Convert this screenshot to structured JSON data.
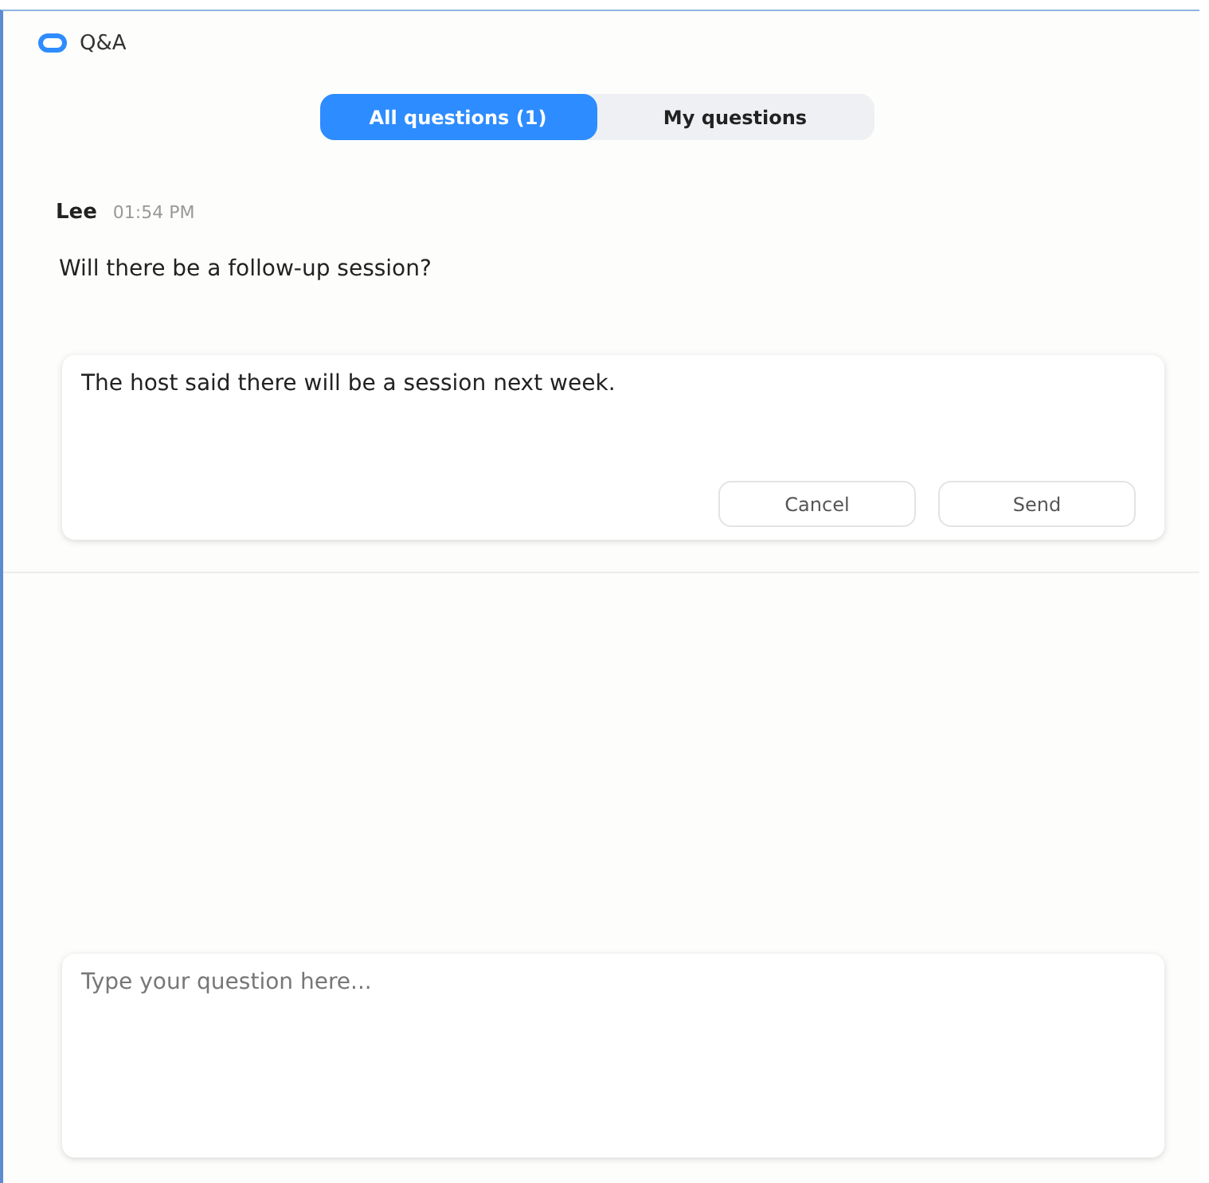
{
  "window": {
    "title": "Q&A"
  },
  "tabs": [
    {
      "label": "All questions (1)",
      "selected": true
    },
    {
      "label": "My questions",
      "selected": false
    }
  ],
  "question": {
    "author": "Lee",
    "time": "01:54 PM",
    "text": "Will there be a follow-up session?"
  },
  "reply": {
    "value": "The host said there will be a session next week.",
    "buttons": [
      "Cancel",
      "Send"
    ]
  },
  "composer": {
    "placeholder": "Type your question here..."
  }
}
